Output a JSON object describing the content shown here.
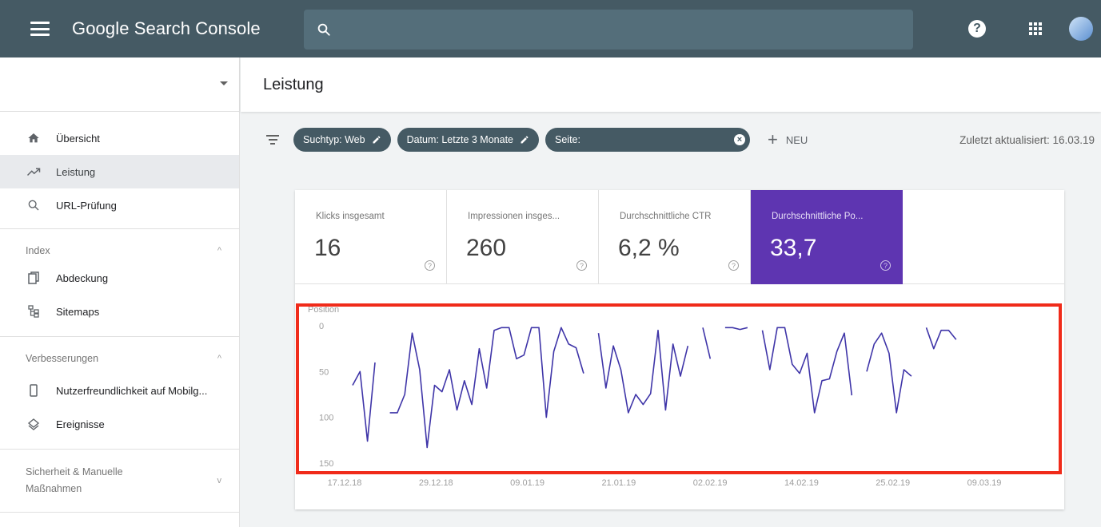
{
  "header": {
    "brand": "Google Search Console",
    "search_placeholder": "",
    "help_icon": "help-circle-icon",
    "apps_icon": "apps-grid-icon"
  },
  "sidebar": {
    "items": [
      {
        "label": "Übersicht",
        "icon": "home-icon",
        "active": false
      },
      {
        "label": "Leistung",
        "icon": "trending-up-icon",
        "active": true
      },
      {
        "label": "URL-Prüfung",
        "icon": "search-icon",
        "active": false
      }
    ],
    "index": {
      "title": "Index",
      "items": [
        {
          "label": "Abdeckung",
          "icon": "coverage-icon"
        },
        {
          "label": "Sitemaps",
          "icon": "sitemap-icon"
        }
      ]
    },
    "enhancements": {
      "title": "Verbesserungen",
      "items": [
        {
          "label": "Nutzerfreundlichkeit auf Mobilg...",
          "icon": "smartphone-icon"
        },
        {
          "label": "Ereignisse",
          "icon": "events-icon"
        }
      ]
    },
    "security": {
      "title_line1": "Sicherheit & Manuelle",
      "title_line2": "Maßnahmen"
    }
  },
  "main": {
    "title": "Leistung",
    "filters": {
      "type_chip": "Suchtyp: Web",
      "date_chip": "Datum: Letzte 3 Monate",
      "page_chip": "Seite:",
      "new_label": "NEU",
      "updated": "Zuletzt aktualisiert: 16.03.19"
    },
    "metrics": [
      {
        "label": "Klicks insgesamt",
        "value": "16",
        "selected": false
      },
      {
        "label": "Impressionen insges...",
        "value": "260",
        "selected": false
      },
      {
        "label": "Durchschnittliche CTR",
        "value": "6,2 %",
        "selected": false
      },
      {
        "label": "Durchschnittliche Po...",
        "value": "33,7",
        "selected": true
      }
    ]
  },
  "colors": {
    "topbar": "#455a64",
    "accent_purple": "#5e35b1",
    "line": "#3f35a8",
    "highlight_box": "#f02b1a"
  },
  "chart_data": {
    "type": "line",
    "title": "",
    "ylabel": "Position",
    "y_reversed": true,
    "ylim": [
      0,
      150
    ],
    "y_ticks": [
      "0",
      "50",
      "100",
      "150"
    ],
    "x_tick_labels": [
      "17.12.18",
      "29.12.18",
      "09.01.19",
      "21.01.19",
      "02.02.19",
      "14.02.19",
      "25.02.19",
      "09.03.19"
    ],
    "x_range_days": [
      0,
      88
    ],
    "series": [
      {
        "values": [
          [
            0,
            65
          ],
          [
            1,
            50
          ],
          [
            2,
            126
          ],
          [
            3,
            40
          ],
          [
            4,
            null
          ],
          [
            5,
            95
          ],
          [
            6,
            95
          ],
          [
            7,
            75
          ],
          [
            8,
            8
          ],
          [
            9,
            48
          ],
          [
            10,
            133
          ],
          [
            11,
            65
          ],
          [
            12,
            72
          ],
          [
            13,
            48
          ],
          [
            14,
            92
          ],
          [
            15,
            60
          ],
          [
            16,
            86
          ],
          [
            17,
            25
          ],
          [
            18,
            68
          ],
          [
            19,
            5
          ],
          [
            20,
            2
          ],
          [
            21,
            2
          ],
          [
            22,
            36
          ],
          [
            23,
            32
          ],
          [
            24,
            2
          ],
          [
            25,
            2
          ],
          [
            26,
            100
          ],
          [
            27,
            28
          ],
          [
            28,
            2
          ],
          [
            29,
            20
          ],
          [
            30,
            24
          ],
          [
            31,
            52
          ],
          [
            32,
            null
          ],
          [
            33,
            8
          ],
          [
            34,
            68
          ],
          [
            35,
            22
          ],
          [
            36,
            48
          ],
          [
            37,
            95
          ],
          [
            38,
            75
          ],
          [
            39,
            86
          ],
          [
            40,
            74
          ],
          [
            41,
            5
          ],
          [
            42,
            92
          ],
          [
            43,
            20
          ],
          [
            44,
            55
          ],
          [
            45,
            22
          ],
          [
            46,
            null
          ],
          [
            47,
            2
          ],
          [
            48,
            36
          ],
          [
            49,
            null
          ],
          [
            50,
            2
          ],
          [
            51,
            2
          ],
          [
            52,
            4
          ],
          [
            53,
            2
          ],
          [
            54,
            null
          ],
          [
            55,
            5
          ],
          [
            56,
            48
          ],
          [
            57,
            2
          ],
          [
            58,
            2
          ],
          [
            59,
            42
          ],
          [
            60,
            52
          ],
          [
            61,
            30
          ],
          [
            62,
            95
          ],
          [
            63,
            60
          ],
          [
            64,
            58
          ],
          [
            65,
            28
          ],
          [
            66,
            8
          ],
          [
            67,
            76
          ],
          [
            68,
            null
          ],
          [
            69,
            50
          ],
          [
            70,
            20
          ],
          [
            71,
            8
          ],
          [
            72,
            30
          ],
          [
            73,
            95
          ],
          [
            74,
            48
          ],
          [
            75,
            55
          ],
          [
            76,
            null
          ],
          [
            77,
            2
          ],
          [
            78,
            25
          ],
          [
            79,
            5
          ],
          [
            80,
            5
          ],
          [
            81,
            15
          ]
        ]
      }
    ]
  }
}
